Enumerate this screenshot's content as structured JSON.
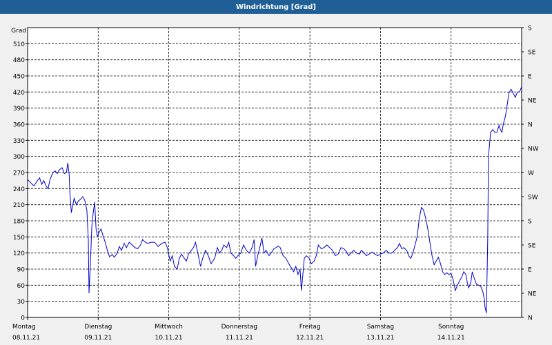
{
  "window": {
    "title": "Windrichtung [Grad]"
  },
  "chart_data": {
    "type": "line",
    "title": "Windrichtung [Grad]",
    "ylabel": "Grad",
    "ylim": [
      0,
      540
    ],
    "y_ticks": [
      0,
      30,
      60,
      90,
      120,
      150,
      180,
      210,
      240,
      270,
      300,
      330,
      360,
      390,
      420,
      450,
      480,
      510
    ],
    "y2_ticks": [
      {
        "value": 0,
        "label": "N"
      },
      {
        "value": 45,
        "label": "NE"
      },
      {
        "value": 90,
        "label": "E"
      },
      {
        "value": 135,
        "label": "SE"
      },
      {
        "value": 180,
        "label": "S"
      },
      {
        "value": 225,
        "label": "SW"
      },
      {
        "value": 270,
        "label": "W"
      },
      {
        "value": 315,
        "label": "NW"
      },
      {
        "value": 360,
        "label": "N"
      },
      {
        "value": 405,
        "label": "NE"
      },
      {
        "value": 450,
        "label": "E"
      },
      {
        "value": 495,
        "label": "SE"
      },
      {
        "value": 540,
        "label": "S"
      }
    ],
    "x_ticks": [
      {
        "day": 0,
        "weekday": "Montag",
        "date": "08.11.21"
      },
      {
        "day": 1,
        "weekday": "Dienstag",
        "date": "09.11.21"
      },
      {
        "day": 2,
        "weekday": "Mittwoch",
        "date": "10.11.21"
      },
      {
        "day": 3,
        "weekday": "Donnerstag",
        "date": "11.11.21"
      },
      {
        "day": 4,
        "weekday": "Freitag",
        "date": "12.11.21"
      },
      {
        "day": 5,
        "weekday": "Samstag",
        "date": "13.11.21"
      },
      {
        "day": 6,
        "weekday": "Sonntag",
        "date": "14.11.21"
      }
    ],
    "xlim": [
      0,
      7
    ],
    "grid": true,
    "color": "#0000cc",
    "series": [
      {
        "points": [
          [
            0.0,
            257
          ],
          [
            0.05,
            250
          ],
          [
            0.09,
            245
          ],
          [
            0.14,
            255
          ],
          [
            0.17,
            260
          ],
          [
            0.2,
            248
          ],
          [
            0.23,
            255
          ],
          [
            0.26,
            245
          ],
          [
            0.29,
            240
          ],
          [
            0.32,
            258
          ],
          [
            0.36,
            270
          ],
          [
            0.39,
            273
          ],
          [
            0.42,
            268
          ],
          [
            0.45,
            275
          ],
          [
            0.49,
            279
          ],
          [
            0.52,
            268
          ],
          [
            0.55,
            270
          ],
          [
            0.57,
            288
          ],
          [
            0.59,
            265
          ],
          [
            0.6,
            230
          ],
          [
            0.62,
            195
          ],
          [
            0.64,
            210
          ],
          [
            0.66,
            222
          ],
          [
            0.69,
            210
          ],
          [
            0.72,
            217
          ],
          [
            0.75,
            220
          ],
          [
            0.78,
            225
          ],
          [
            0.81,
            218
          ],
          [
            0.84,
            200
          ],
          [
            0.86,
            145
          ],
          [
            0.87,
            45
          ],
          [
            0.89,
            100
          ],
          [
            0.91,
            170
          ],
          [
            0.93,
            195
          ],
          [
            0.95,
            215
          ],
          [
            0.97,
            165
          ],
          [
            0.99,
            150
          ],
          [
            1.01,
            158
          ],
          [
            1.04,
            165
          ],
          [
            1.07,
            152
          ],
          [
            1.1,
            140
          ],
          [
            1.13,
            125
          ],
          [
            1.16,
            113
          ],
          [
            1.2,
            117
          ],
          [
            1.23,
            112
          ],
          [
            1.27,
            120
          ],
          [
            1.3,
            132
          ],
          [
            1.33,
            125
          ],
          [
            1.37,
            138
          ],
          [
            1.4,
            130
          ],
          [
            1.44,
            140
          ],
          [
            1.48,
            135
          ],
          [
            1.52,
            130
          ],
          [
            1.56,
            128
          ],
          [
            1.6,
            135
          ],
          [
            1.63,
            145
          ],
          [
            1.67,
            140
          ],
          [
            1.7,
            138
          ],
          [
            1.75,
            140
          ],
          [
            1.8,
            140
          ],
          [
            1.85,
            132
          ],
          [
            1.9,
            138
          ],
          [
            1.95,
            140
          ],
          [
            1.98,
            130
          ],
          [
            2.02,
            105
          ],
          [
            2.05,
            115
          ],
          [
            2.08,
            95
          ],
          [
            2.12,
            90
          ],
          [
            2.15,
            110
          ],
          [
            2.18,
            118
          ],
          [
            2.22,
            110
          ],
          [
            2.25,
            105
          ],
          [
            2.28,
            118
          ],
          [
            2.32,
            125
          ],
          [
            2.35,
            130
          ],
          [
            2.38,
            140
          ],
          [
            2.42,
            115
          ],
          [
            2.45,
            95
          ],
          [
            2.48,
            110
          ],
          [
            2.52,
            125
          ],
          [
            2.56,
            115
          ],
          [
            2.6,
            100
          ],
          [
            2.65,
            110
          ],
          [
            2.69,
            130
          ],
          [
            2.72,
            120
          ],
          [
            2.75,
            125
          ],
          [
            2.78,
            135
          ],
          [
            2.82,
            130
          ],
          [
            2.85,
            140
          ],
          [
            2.88,
            120
          ],
          [
            2.92,
            115
          ],
          [
            2.95,
            110
          ],
          [
            2.98,
            115
          ],
          [
            3.02,
            120
          ],
          [
            3.06,
            135
          ],
          [
            3.1,
            125
          ],
          [
            3.14,
            120
          ],
          [
            3.18,
            130
          ],
          [
            3.21,
            145
          ],
          [
            3.23,
            95
          ],
          [
            3.26,
            115
          ],
          [
            3.29,
            130
          ],
          [
            3.32,
            148
          ],
          [
            3.35,
            120
          ],
          [
            3.38,
            125
          ],
          [
            3.42,
            115
          ],
          [
            3.45,
            120
          ],
          [
            3.49,
            128
          ],
          [
            3.52,
            130
          ],
          [
            3.55,
            133
          ],
          [
            3.58,
            130
          ],
          [
            3.62,
            115
          ],
          [
            3.66,
            110
          ],
          [
            3.7,
            100
          ],
          [
            3.74,
            92
          ],
          [
            3.77,
            85
          ],
          [
            3.8,
            95
          ],
          [
            3.83,
            80
          ],
          [
            3.86,
            90
          ],
          [
            3.88,
            50
          ],
          [
            3.92,
            110
          ],
          [
            3.95,
            115
          ],
          [
            3.99,
            110
          ],
          [
            4.02,
            100
          ],
          [
            4.06,
            105
          ],
          [
            4.09,
            115
          ],
          [
            4.12,
            135
          ],
          [
            4.16,
            128
          ],
          [
            4.2,
            130
          ],
          [
            4.24,
            135
          ],
          [
            4.28,
            130
          ],
          [
            4.32,
            125
          ],
          [
            4.36,
            115
          ],
          [
            4.4,
            118
          ],
          [
            4.44,
            130
          ],
          [
            4.48,
            128
          ],
          [
            4.52,
            122
          ],
          [
            4.55,
            115
          ],
          [
            4.58,
            120
          ],
          [
            4.62,
            125
          ],
          [
            4.66,
            120
          ],
          [
            4.7,
            118
          ],
          [
            4.73,
            125
          ],
          [
            4.77,
            120
          ],
          [
            4.8,
            115
          ],
          [
            4.84,
            118
          ],
          [
            4.88,
            122
          ],
          [
            4.92,
            118
          ],
          [
            4.96,
            115
          ],
          [
            5.0,
            118
          ],
          [
            5.04,
            120
          ],
          [
            5.08,
            125
          ],
          [
            5.12,
            120
          ],
          [
            5.16,
            120
          ],
          [
            5.2,
            125
          ],
          [
            5.24,
            130
          ],
          [
            5.27,
            138
          ],
          [
            5.3,
            128
          ],
          [
            5.33,
            130
          ],
          [
            5.37,
            125
          ],
          [
            5.4,
            115
          ],
          [
            5.43,
            110
          ],
          [
            5.46,
            120
          ],
          [
            5.49,
            135
          ],
          [
            5.52,
            150
          ],
          [
            5.55,
            185
          ],
          [
            5.58,
            205
          ],
          [
            5.61,
            200
          ],
          [
            5.64,
            185
          ],
          [
            5.67,
            165
          ],
          [
            5.7,
            140
          ],
          [
            5.73,
            115
          ],
          [
            5.76,
            98
          ],
          [
            5.79,
            105
          ],
          [
            5.82,
            112
          ],
          [
            5.85,
            100
          ],
          [
            5.88,
            85
          ],
          [
            5.91,
            80
          ],
          [
            5.94,
            83
          ],
          [
            5.97,
            80
          ],
          [
            6.0,
            82
          ],
          [
            6.03,
            70
          ],
          [
            6.06,
            50
          ],
          [
            6.09,
            60
          ],
          [
            6.12,
            68
          ],
          [
            6.15,
            75
          ],
          [
            6.18,
            85
          ],
          [
            6.21,
            80
          ],
          [
            6.23,
            65
          ],
          [
            6.25,
            55
          ],
          [
            6.28,
            65
          ],
          [
            6.3,
            85
          ],
          [
            6.33,
            72
          ],
          [
            6.36,
            62
          ],
          [
            6.39,
            60
          ],
          [
            6.42,
            58
          ],
          [
            6.45,
            48
          ],
          [
            6.47,
            35
          ],
          [
            6.48,
            20
          ],
          [
            6.5,
            8
          ],
          [
            6.52,
            150
          ],
          [
            6.53,
            300
          ],
          [
            6.56,
            345
          ],
          [
            6.59,
            350
          ],
          [
            6.62,
            345
          ],
          [
            6.65,
            345
          ],
          [
            6.68,
            358
          ],
          [
            6.7,
            350
          ],
          [
            6.72,
            345
          ],
          [
            6.74,
            360
          ],
          [
            6.77,
            375
          ],
          [
            6.8,
            400
          ],
          [
            6.82,
            418
          ],
          [
            6.85,
            425
          ],
          [
            6.88,
            418
          ],
          [
            6.91,
            410
          ],
          [
            6.94,
            420
          ],
          [
            6.97,
            420
          ],
          [
            7.0,
            430
          ]
        ]
      }
    ]
  }
}
